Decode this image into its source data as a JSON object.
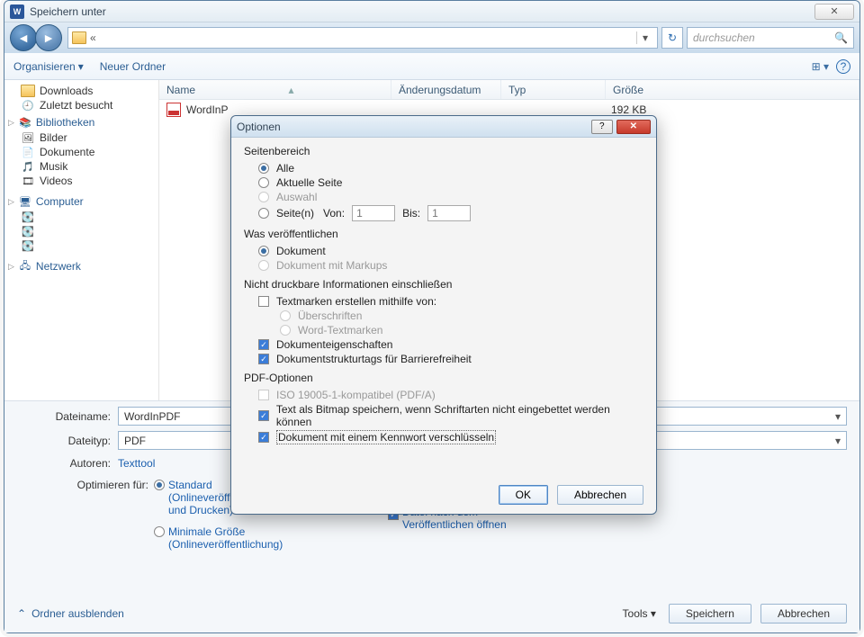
{
  "window": {
    "title": "Speichern unter",
    "close_symbol": "✕"
  },
  "nav": {
    "breadcrumb": "«",
    "search_placeholder": "durchsuchen"
  },
  "toolbar": {
    "organize": "Organisieren",
    "new_folder": "Neuer Ordner"
  },
  "side": {
    "downloads": "Downloads",
    "recent": "Zuletzt besucht",
    "libraries": "Bibliotheken",
    "pictures": "Bilder",
    "documents": "Dokumente",
    "music": "Musik",
    "videos": "Videos",
    "computer": "Computer",
    "network": "Netzwerk"
  },
  "cols": {
    "name": "Name",
    "modified": "Änderungsdatum",
    "type": "Typ",
    "size": "Größe"
  },
  "row": {
    "name": "WordInP",
    "size": "192 KB"
  },
  "form": {
    "filename_lbl": "Dateiname:",
    "filename_val": "WordInPDF",
    "filetype_lbl": "Dateityp:",
    "filetype_val": "PDF",
    "authors_lbl": "Autoren:",
    "authors_val": "Texttool",
    "optimize_lbl": "Optimieren für:",
    "opt_standard": "Standard (Onlineveröffentlichung und Drucken)",
    "opt_minimal": "Minimale Größe (Onlineveröffentlichung)",
    "open_after": "Datei nach dem Veröffentlichen öffnen",
    "tools": "Tools",
    "save": "Speichern",
    "cancel": "Abbrechen",
    "hide_folders": "Ordner ausblenden"
  },
  "modal": {
    "title": "Optionen",
    "page_range": "Seitenbereich",
    "all": "Alle",
    "current": "Aktuelle Seite",
    "selection": "Auswahl",
    "pages": "Seite(n)",
    "from": "Von:",
    "to": "Bis:",
    "from_val": "1",
    "to_val": "1",
    "publish_what": "Was veröffentlichen",
    "document": "Dokument",
    "with_markup": "Dokument mit Markups",
    "nonprint": "Nicht druckbare Informationen einschließen",
    "bookmarks": "Textmarken erstellen mithilfe von:",
    "headings": "Überschriften",
    "word_bookmarks": "Word-Textmarken",
    "docprops": "Dokumenteigenschaften",
    "structuretags": "Dokumentstrukturtags für Barrierefreiheit",
    "pdfoptions": "PDF-Optionen",
    "pdfa": "ISO 19005-1-kompatibel (PDF/A)",
    "bitmap": "Text als Bitmap speichern, wenn Schriftarten nicht eingebettet werden können",
    "encrypt": "Dokument mit einem Kennwort verschlüsseln",
    "ok": "OK",
    "cancel": "Abbrechen"
  }
}
